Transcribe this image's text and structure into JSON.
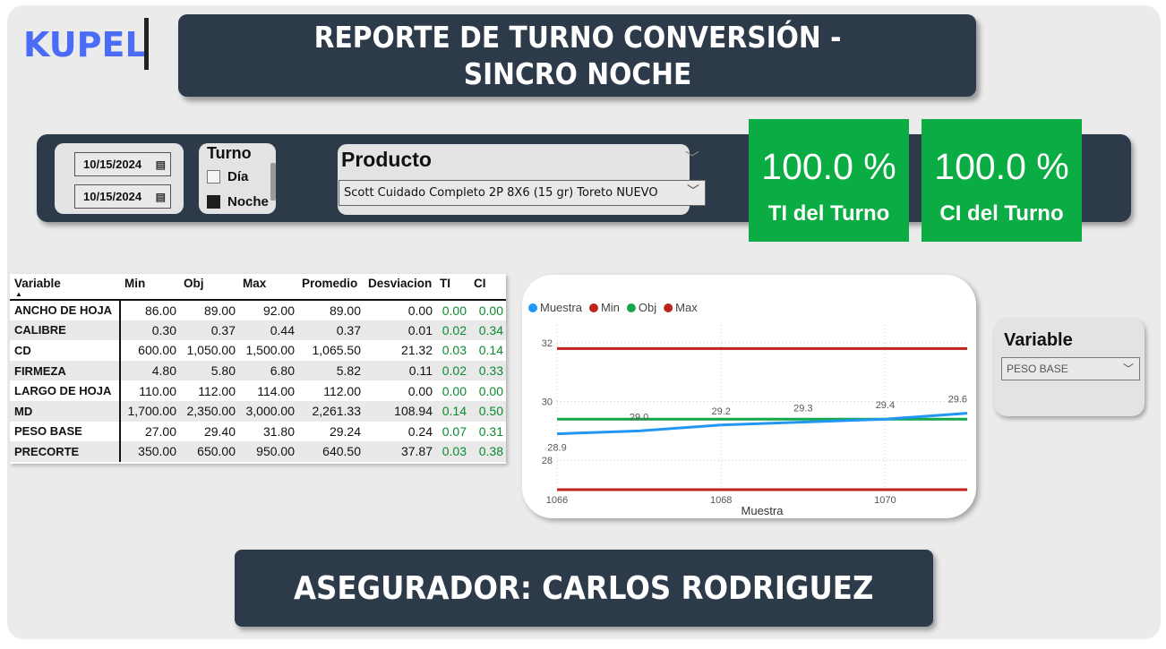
{
  "header": {
    "logo": "KUPEL",
    "title": "REPORTE DE TURNO CONVERSIÓN - SINCRO NOCHE"
  },
  "filters": {
    "date_start": "10/15/2024",
    "date_end": "10/15/2024",
    "turno": {
      "title": "Turno",
      "options": [
        {
          "label": "Día",
          "checked": false
        },
        {
          "label": "Noche",
          "checked": true
        }
      ]
    },
    "producto": {
      "title": "Producto",
      "selected": "Scott Cuidado Completo 2P 8X6 (15 gr) Toreto NUEVO"
    }
  },
  "kpis": [
    {
      "value": "100.0 %",
      "label": "TI del Turno"
    },
    {
      "value": "100.0 %",
      "label": "CI del Turno"
    }
  ],
  "table": {
    "headers": [
      "Variable",
      "Min",
      "Obj",
      "Max",
      "Promedio",
      "Desviacion",
      "TI",
      "CI"
    ],
    "rows": [
      [
        "ANCHO DE HOJA",
        "86.00",
        "89.00",
        "92.00",
        "89.00",
        "0.00",
        "0.00",
        "0.00"
      ],
      [
        "CALIBRE",
        "0.30",
        "0.37",
        "0.44",
        "0.37",
        "0.01",
        "0.02",
        "0.34"
      ],
      [
        "CD",
        "600.00",
        "1,050.00",
        "1,500.00",
        "1,065.50",
        "21.32",
        "0.03",
        "0.14"
      ],
      [
        "FIRMEZA",
        "4.80",
        "5.80",
        "6.80",
        "5.82",
        "0.11",
        "0.02",
        "0.33"
      ],
      [
        "LARGO DE HOJA",
        "110.00",
        "112.00",
        "114.00",
        "112.00",
        "0.00",
        "0.00",
        "0.00"
      ],
      [
        "MD",
        "1,700.00",
        "2,350.00",
        "3,000.00",
        "2,261.33",
        "108.94",
        "0.14",
        "0.50"
      ],
      [
        "PESO BASE",
        "27.00",
        "29.40",
        "31.80",
        "29.24",
        "0.24",
        "0.07",
        "0.31"
      ],
      [
        "PRECORTE",
        "350.00",
        "650.00",
        "950.00",
        "640.50",
        "37.87",
        "0.03",
        "0.38"
      ]
    ]
  },
  "variable_slicer": {
    "title": "Variable",
    "selected": "PESO BASE"
  },
  "footer": {
    "text": "ASEGURADOR: CARLOS RODRIGUEZ"
  },
  "chart_data": {
    "type": "line",
    "xlabel": "Muestra",
    "ylabel": "",
    "x": [
      1066,
      1067,
      1068,
      1069,
      1070,
      1071
    ],
    "x_ticks": [
      1066,
      1068,
      1070
    ],
    "y_ticks": [
      28,
      30,
      32
    ],
    "ylim": [
      27.0,
      32.3
    ],
    "xlim": [
      1066,
      1071
    ],
    "grid": true,
    "legend_position": "top-left",
    "series": [
      {
        "name": "Muestra",
        "color": "#2196f3",
        "values": [
          28.9,
          29.0,
          29.2,
          29.3,
          29.4,
          29.6
        ],
        "labels": [
          "28.9",
          "29.0",
          "29.2",
          "29.3",
          "29.4",
          "29.6"
        ]
      },
      {
        "name": "Min",
        "color": "#c0231c",
        "values": [
          27.0,
          27.0,
          27.0,
          27.0,
          27.0,
          27.0
        ]
      },
      {
        "name": "Obj",
        "color": "#12a84a",
        "values": [
          29.4,
          29.4,
          29.4,
          29.4,
          29.4,
          29.4
        ]
      },
      {
        "name": "Max",
        "color": "#c0231c",
        "values": [
          31.8,
          31.8,
          31.8,
          31.8,
          31.8,
          31.8
        ]
      }
    ]
  }
}
